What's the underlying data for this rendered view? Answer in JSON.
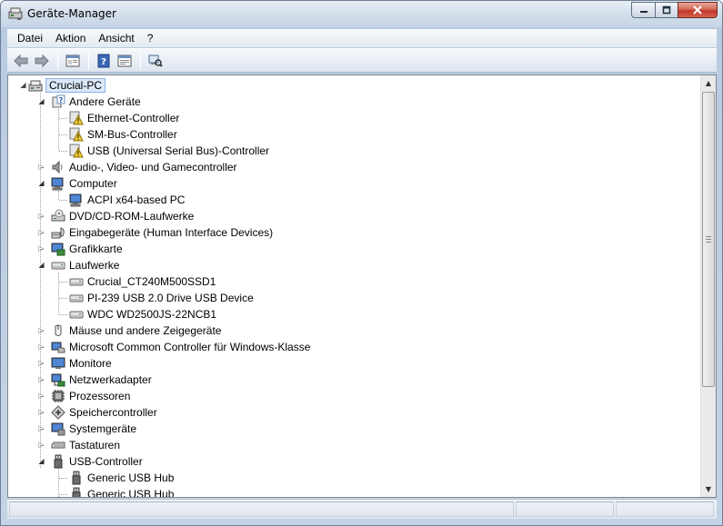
{
  "window": {
    "title": "Geräte-Manager",
    "icon": "device-manager-icon"
  },
  "menu": [
    "Datei",
    "Aktion",
    "Ansicht",
    "?"
  ],
  "toolbar": {
    "buttons": [
      "back-icon",
      "forward-icon",
      "show-hide-console-tree-icon",
      "help-icon",
      "properties-icon",
      "scan-hardware-icon"
    ]
  },
  "tree": {
    "root": "Crucial-PC",
    "nodes": [
      {
        "label": "Andere Geräte",
        "level": 1,
        "state": "expanded",
        "icon": "unknown-device-icon"
      },
      {
        "label": "Ethernet-Controller",
        "level": 2,
        "state": "leaf",
        "icon": "warning-device-icon"
      },
      {
        "label": "SM-Bus-Controller",
        "level": 2,
        "state": "leaf",
        "icon": "warning-device-icon"
      },
      {
        "label": "USB (Universal Serial Bus)-Controller",
        "level": 2,
        "state": "leaf",
        "icon": "warning-device-icon"
      },
      {
        "label": "Audio-, Video- und Gamecontroller",
        "level": 1,
        "state": "collapsed",
        "icon": "speaker-icon"
      },
      {
        "label": "Computer",
        "level": 1,
        "state": "expanded",
        "icon": "computer-icon"
      },
      {
        "label": "ACPI x64-based PC",
        "level": 2,
        "state": "leaf",
        "icon": "computer-icon"
      },
      {
        "label": "DVD/CD-ROM-Laufwerke",
        "level": 1,
        "state": "collapsed",
        "icon": "dvd-drive-icon"
      },
      {
        "label": "Eingabegeräte (Human Interface Devices)",
        "level": 1,
        "state": "collapsed",
        "icon": "hid-icon"
      },
      {
        "label": "Grafikkarte",
        "level": 1,
        "state": "collapsed",
        "icon": "display-adapter-icon"
      },
      {
        "label": "Laufwerke",
        "level": 1,
        "state": "expanded",
        "icon": "disk-drive-icon"
      },
      {
        "label": "Crucial_CT240M500SSD1",
        "level": 2,
        "state": "leaf",
        "icon": "disk-drive-icon"
      },
      {
        "label": "PI-239 USB 2.0 Drive USB Device",
        "level": 2,
        "state": "leaf",
        "icon": "disk-drive-icon"
      },
      {
        "label": "WDC WD2500JS-22NCB1",
        "level": 2,
        "state": "leaf",
        "icon": "disk-drive-icon"
      },
      {
        "label": "Mäuse und andere Zeigegeräte",
        "level": 1,
        "state": "collapsed",
        "icon": "mouse-icon"
      },
      {
        "label": "Microsoft Common Controller für Windows-Klasse",
        "level": 1,
        "state": "collapsed",
        "icon": "controller-icon"
      },
      {
        "label": "Monitore",
        "level": 1,
        "state": "collapsed",
        "icon": "monitor-icon"
      },
      {
        "label": "Netzwerkadapter",
        "level": 1,
        "state": "collapsed",
        "icon": "network-adapter-icon"
      },
      {
        "label": "Prozessoren",
        "level": 1,
        "state": "collapsed",
        "icon": "processor-icon"
      },
      {
        "label": "Speichercontroller",
        "level": 1,
        "state": "collapsed",
        "icon": "storage-controller-icon"
      },
      {
        "label": "Systemgeräte",
        "level": 1,
        "state": "collapsed",
        "icon": "system-devices-icon"
      },
      {
        "label": "Tastaturen",
        "level": 1,
        "state": "collapsed",
        "icon": "keyboard-icon"
      },
      {
        "label": "USB-Controller",
        "level": 1,
        "state": "expanded",
        "icon": "usb-icon"
      },
      {
        "label": "Generic USB Hub",
        "level": 2,
        "state": "leaf",
        "icon": "usb-icon"
      },
      {
        "label": "Generic USB Hub",
        "level": 2,
        "state": "leaf",
        "icon": "usb-icon"
      }
    ]
  }
}
